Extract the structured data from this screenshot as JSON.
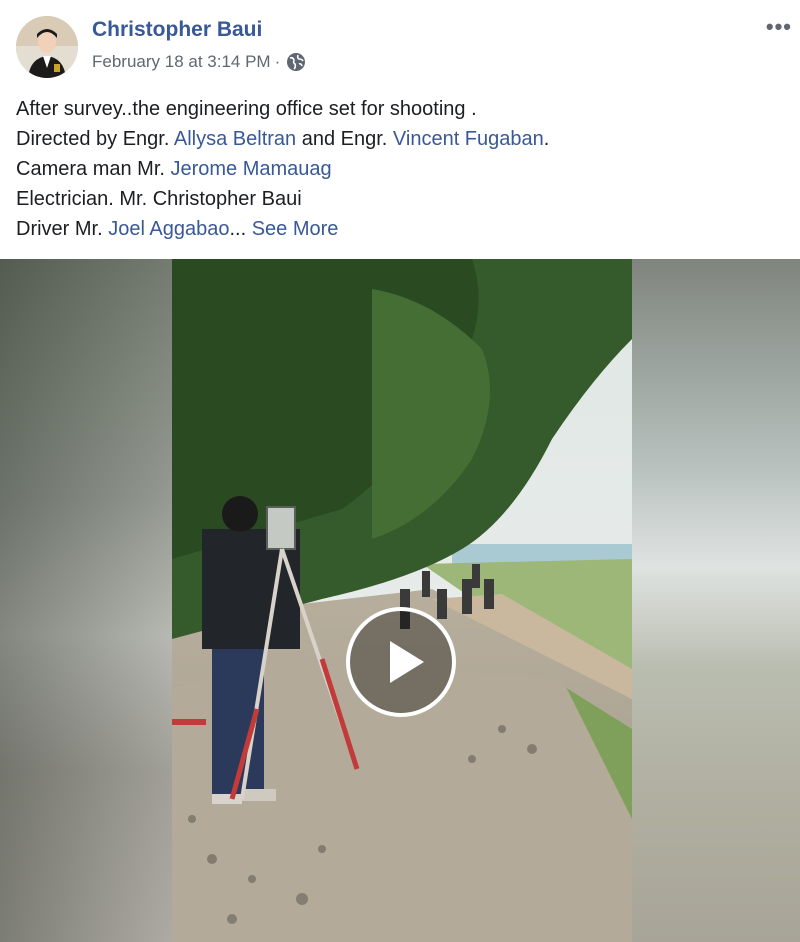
{
  "post": {
    "author": "Christopher Baui",
    "timestamp": "February 18 at 3:14 PM",
    "separator": "·",
    "privacy_icon": "globe-icon",
    "more_icon": "•••"
  },
  "caption": {
    "line1": "After survey..the engineering office set for shooting .",
    "line2_prefix": "Directed by Engr. ",
    "line2_link1": "Allysa Beltran",
    "line2_mid": " and Engr. ",
    "line2_link2": "Vincent Fugaban",
    "line2_suffix": ".",
    "line3_prefix": "Camera man Mr. ",
    "line3_link": "Jerome Mamauag",
    "line4": "Electrician. Mr. Christopher Baui",
    "line5_prefix": "Driver Mr. ",
    "line5_link": "Joel Aggabao",
    "line5_ellipsis": "...",
    "see_more": "See More"
  },
  "media": {
    "type": "video",
    "play_icon": "play-icon"
  },
  "colors": {
    "link": "#385898",
    "text": "#1c1e21",
    "meta": "#616770"
  }
}
